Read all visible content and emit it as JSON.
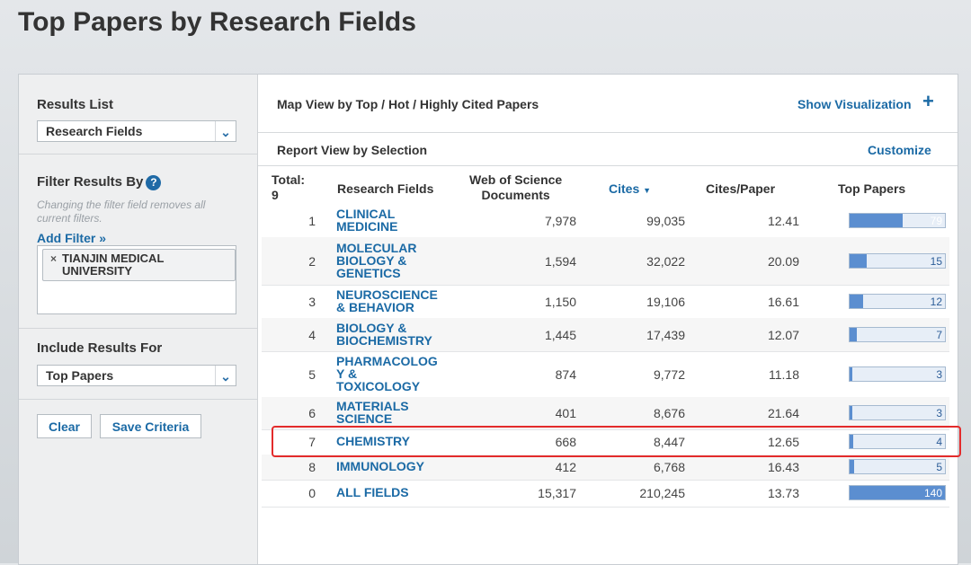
{
  "page_title": "Top Papers by Research Fields",
  "sidebar": {
    "results_list_label": "Results List",
    "results_list_value": "Research Fields",
    "filter_label": "Filter Results By",
    "filter_hint": "Changing the filter field removes all current filters.",
    "add_filter": "Add Filter »",
    "active_filter_line1": "TIANJIN MEDICAL",
    "active_filter_line2": "UNIVERSITY",
    "include_label": "Include Results For",
    "include_value": "Top Papers",
    "clear_button": "Clear",
    "save_button": "Save Criteria"
  },
  "main": {
    "map_view_title": "Map View by Top / Hot / Highly Cited Papers",
    "show_visualization": "Show Visualization",
    "report_view_title": "Report View by Selection",
    "customize": "Customize"
  },
  "table": {
    "headers": {
      "total_label": "Total:",
      "total_value": "9",
      "field": "Research Fields",
      "docs_line1": "Web of Science",
      "docs_line2": "Documents",
      "cites": "Cites",
      "cites_per_paper": "Cites/Paper",
      "top_papers": "Top Papers"
    },
    "rows": [
      {
        "rank": "1",
        "field_lines": [
          "CLINICAL",
          "MEDICINE"
        ],
        "docs": "7,978",
        "cites": "99,035",
        "cpp": "12.41",
        "top": "79",
        "fill": 0.56
      },
      {
        "rank": "2",
        "field_lines": [
          "MOLECULAR",
          "BIOLOGY &",
          "GENETICS"
        ],
        "docs": "1,594",
        "cites": "32,022",
        "cpp": "20.09",
        "top": "15",
        "fill": 0.18
      },
      {
        "rank": "3",
        "field_lines": [
          "NEUROSCIENCE",
          "& BEHAVIOR"
        ],
        "docs": "1,150",
        "cites": "19,106",
        "cpp": "16.61",
        "top": "12",
        "fill": 0.14
      },
      {
        "rank": "4",
        "field_lines": [
          "BIOLOGY &",
          "BIOCHEMISTRY"
        ],
        "docs": "1,445",
        "cites": "17,439",
        "cpp": "12.07",
        "top": "7",
        "fill": 0.08
      },
      {
        "rank": "5",
        "field_lines": [
          "PHARMACOLOG",
          "Y &",
          "TOXICOLOGY"
        ],
        "docs": "874",
        "cites": "9,772",
        "cpp": "11.18",
        "top": "3",
        "fill": 0.03
      },
      {
        "rank": "6",
        "field_lines": [
          "MATERIALS",
          "SCIENCE"
        ],
        "docs": "401",
        "cites": "8,676",
        "cpp": "21.64",
        "top": "3",
        "fill": 0.03
      },
      {
        "rank": "7",
        "field_lines": [
          "CHEMISTRY"
        ],
        "docs": "668",
        "cites": "8,447",
        "cpp": "12.65",
        "top": "4",
        "fill": 0.04
      },
      {
        "rank": "8",
        "field_lines": [
          "IMMUNOLOGY"
        ],
        "docs": "412",
        "cites": "6,768",
        "cpp": "16.43",
        "top": "5",
        "fill": 0.05
      },
      {
        "rank": "0",
        "field_lines": [
          "ALL FIELDS"
        ],
        "docs": "15,317",
        "cites": "210,245",
        "cpp": "13.73",
        "top": "140",
        "fill": 1.0
      }
    ]
  },
  "colors": {
    "link": "#1b6aa5",
    "bar_fill": "#5b8ed0",
    "highlight": "#e32b2b"
  }
}
